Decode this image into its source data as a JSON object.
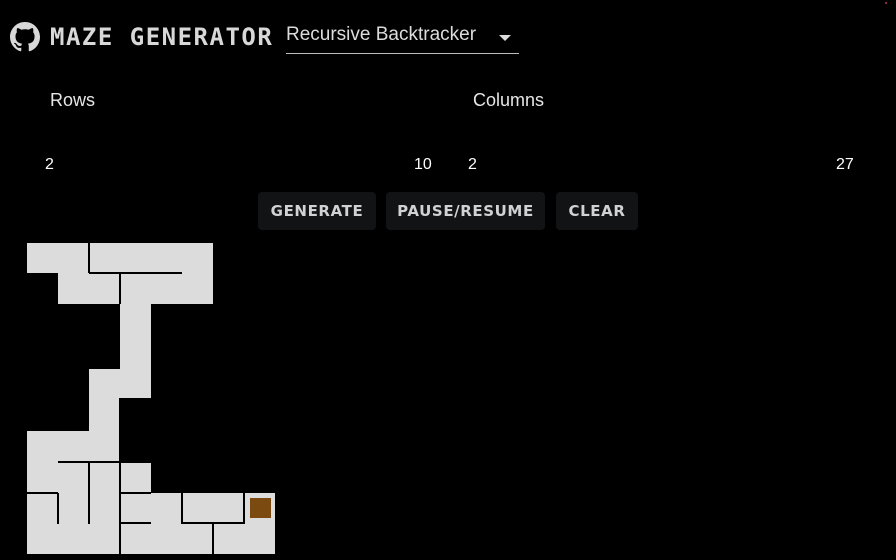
{
  "header": {
    "title": "MAZE GENERATOR",
    "github_icon": "github-icon",
    "algorithm_selected": "Recursive Backtracker",
    "dropdown_icon": "caret-down-icon"
  },
  "rows_slider": {
    "label": "Rows",
    "min": "2",
    "max": "10"
  },
  "columns_slider": {
    "label": "Columns",
    "min": "2",
    "max": "27"
  },
  "buttons": {
    "generate": "GENERATE",
    "pause_resume": "PAUSE/RESUME",
    "clear": "CLEAR"
  },
  "colors": {
    "background": "#000000",
    "maze_cell": "#dcdcdc",
    "maze_wall": "#000000",
    "current_cell": "#7a4a10",
    "button_bg": "#111315"
  }
}
